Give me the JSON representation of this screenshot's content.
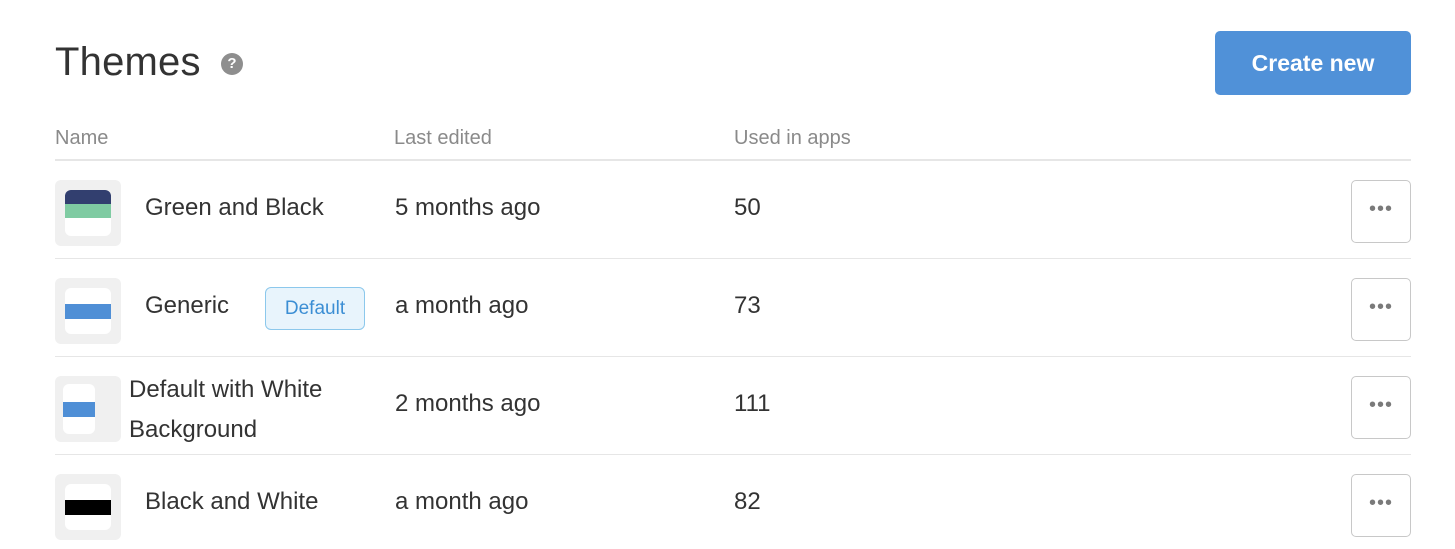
{
  "header": {
    "title": "Themes",
    "help_icon": "help-circle-icon",
    "create_button": "Create new"
  },
  "table": {
    "columns": [
      "Name",
      "Last edited",
      "Used in apps"
    ],
    "rows": [
      {
        "name": "Green and Black",
        "badge": "",
        "last_edited": "5 months ago",
        "used_in_apps": "50",
        "thumbnail_colors": [
          "#323f6f",
          "#7fcba2"
        ],
        "more_icon": "more-horizontal-icon"
      },
      {
        "name": "Generic",
        "badge": "Default",
        "last_edited": "a month ago",
        "used_in_apps": "73",
        "thumbnail_colors": [
          "#4f8fd6"
        ],
        "more_icon": "more-horizontal-icon"
      },
      {
        "name": "Default with White Background",
        "badge": "",
        "last_edited": "2 months ago",
        "used_in_apps": "111",
        "thumbnail_colors": [
          "#4f8fd6"
        ],
        "more_icon": "more-horizontal-icon"
      },
      {
        "name": "Black and White",
        "badge": "",
        "last_edited": "a month ago",
        "used_in_apps": "82",
        "thumbnail_colors": [
          "#000000"
        ],
        "more_icon": "more-horizontal-icon"
      }
    ]
  },
  "colors": {
    "accent": "#5091d8",
    "badge_border": "#8cc8ec",
    "badge_text": "#3b8ed4"
  }
}
